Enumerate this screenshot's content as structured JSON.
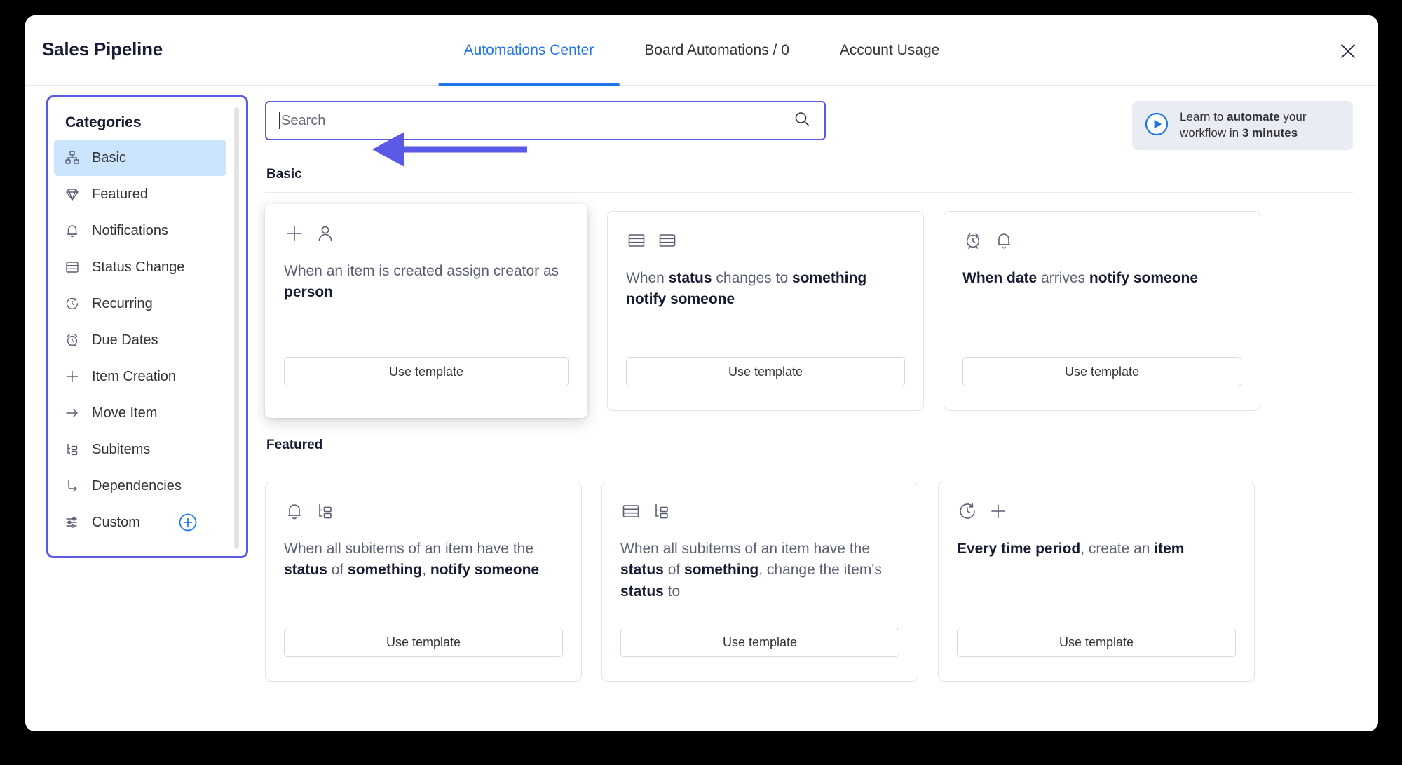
{
  "window": {
    "board_title": "Sales Pipeline",
    "close_icon": "close-icon"
  },
  "header": {
    "tabs": [
      {
        "label": "Automations Center",
        "active": true
      },
      {
        "label": "Board Automations / 0",
        "active": false
      },
      {
        "label": "Account Usage",
        "active": false
      }
    ],
    "active_tab_color": "#1f76e8"
  },
  "sidebar": {
    "heading": "Categories",
    "accent_border_color": "#5a5ae6",
    "selected_bg_color": "#cce5ff",
    "add_button_color": "#1f76e8",
    "items": [
      {
        "label": "Basic",
        "icon": "blocks-icon",
        "selected": true
      },
      {
        "label": "Featured",
        "icon": "diamond-icon",
        "selected": false
      },
      {
        "label": "Notifications",
        "icon": "bell-icon",
        "selected": false
      },
      {
        "label": "Status Change",
        "icon": "status-column-icon",
        "selected": false
      },
      {
        "label": "Recurring",
        "icon": "recurring-clock-icon",
        "selected": false
      },
      {
        "label": "Due Dates",
        "icon": "alarm-clock-icon",
        "selected": false
      },
      {
        "label": "Item Creation",
        "icon": "plus-icon",
        "selected": false
      },
      {
        "label": "Move Item",
        "icon": "arrow-right-icon",
        "selected": false
      },
      {
        "label": "Subitems",
        "icon": "subitems-icon",
        "selected": false
      },
      {
        "label": "Dependencies",
        "icon": "dependency-icon",
        "selected": false
      },
      {
        "label": "Custom",
        "icon": "sliders-icon",
        "selected": false,
        "add_button": "add-custom-icon"
      }
    ]
  },
  "search": {
    "placeholder": "Search",
    "value": "",
    "icon": "search-icon",
    "focused": true
  },
  "promo": {
    "icon": "play-circle-icon",
    "line1_prefix": "Learn to ",
    "line1_bold": "automate",
    "line1_suffix": " your",
    "line2_prefix": "workflow in ",
    "line2_bold": "3 minutes",
    "line2_suffix": ""
  },
  "annotation": {
    "type": "left-arrow",
    "color": "#5a5ae6",
    "target": "search-input"
  },
  "sections": [
    {
      "title": "Basic",
      "cards": [
        {
          "icons": [
            "plus-icon",
            "person-icon"
          ],
          "hovered": true,
          "parts": [
            {
              "t": "When an item is created assign creator as ",
              "b": false
            },
            {
              "t": "person",
              "b": true
            }
          ],
          "button": "Use template"
        },
        {
          "icons": [
            "status-column-icon",
            "status-column-icon"
          ],
          "hovered": false,
          "parts": [
            {
              "t": "When ",
              "b": false
            },
            {
              "t": "status",
              "b": true
            },
            {
              "t": " changes to ",
              "b": false
            },
            {
              "t": "something notify someone",
              "b": true
            }
          ],
          "button": "Use template"
        },
        {
          "icons": [
            "alarm-clock-icon",
            "bell-icon"
          ],
          "hovered": false,
          "parts": [
            {
              "t": "When ",
              "b": true
            },
            {
              "t": "date",
              "b": true
            },
            {
              "t": " arrives ",
              "b": false
            },
            {
              "t": "notify someone",
              "b": true
            }
          ],
          "button": "Use template"
        }
      ]
    },
    {
      "title": "Featured",
      "cards": [
        {
          "icons": [
            "bell-icon",
            "subitems-icon"
          ],
          "hovered": false,
          "parts": [
            {
              "t": "When all subitems of an item have the ",
              "b": false
            },
            {
              "t": "status",
              "b": true
            },
            {
              "t": " of ",
              "b": false
            },
            {
              "t": "something",
              "b": true
            },
            {
              "t": ", ",
              "b": false
            },
            {
              "t": "notify someone",
              "b": true
            }
          ],
          "button": "Use template"
        },
        {
          "icons": [
            "status-column-icon",
            "subitems-icon"
          ],
          "hovered": false,
          "parts": [
            {
              "t": "When all subitems of an item have the ",
              "b": false
            },
            {
              "t": "status",
              "b": true
            },
            {
              "t": " of ",
              "b": false
            },
            {
              "t": "something",
              "b": true
            },
            {
              "t": ", change the item's ",
              "b": false
            },
            {
              "t": "status",
              "b": true
            },
            {
              "t": " to",
              "b": false
            }
          ],
          "button": "Use template"
        },
        {
          "icons": [
            "recurring-clock-icon",
            "plus-icon"
          ],
          "hovered": false,
          "parts": [
            {
              "t": "Every time period",
              "b": true
            },
            {
              "t": ", create an ",
              "b": false
            },
            {
              "t": "item",
              "b": true
            }
          ],
          "button": "Use template"
        }
      ]
    }
  ]
}
